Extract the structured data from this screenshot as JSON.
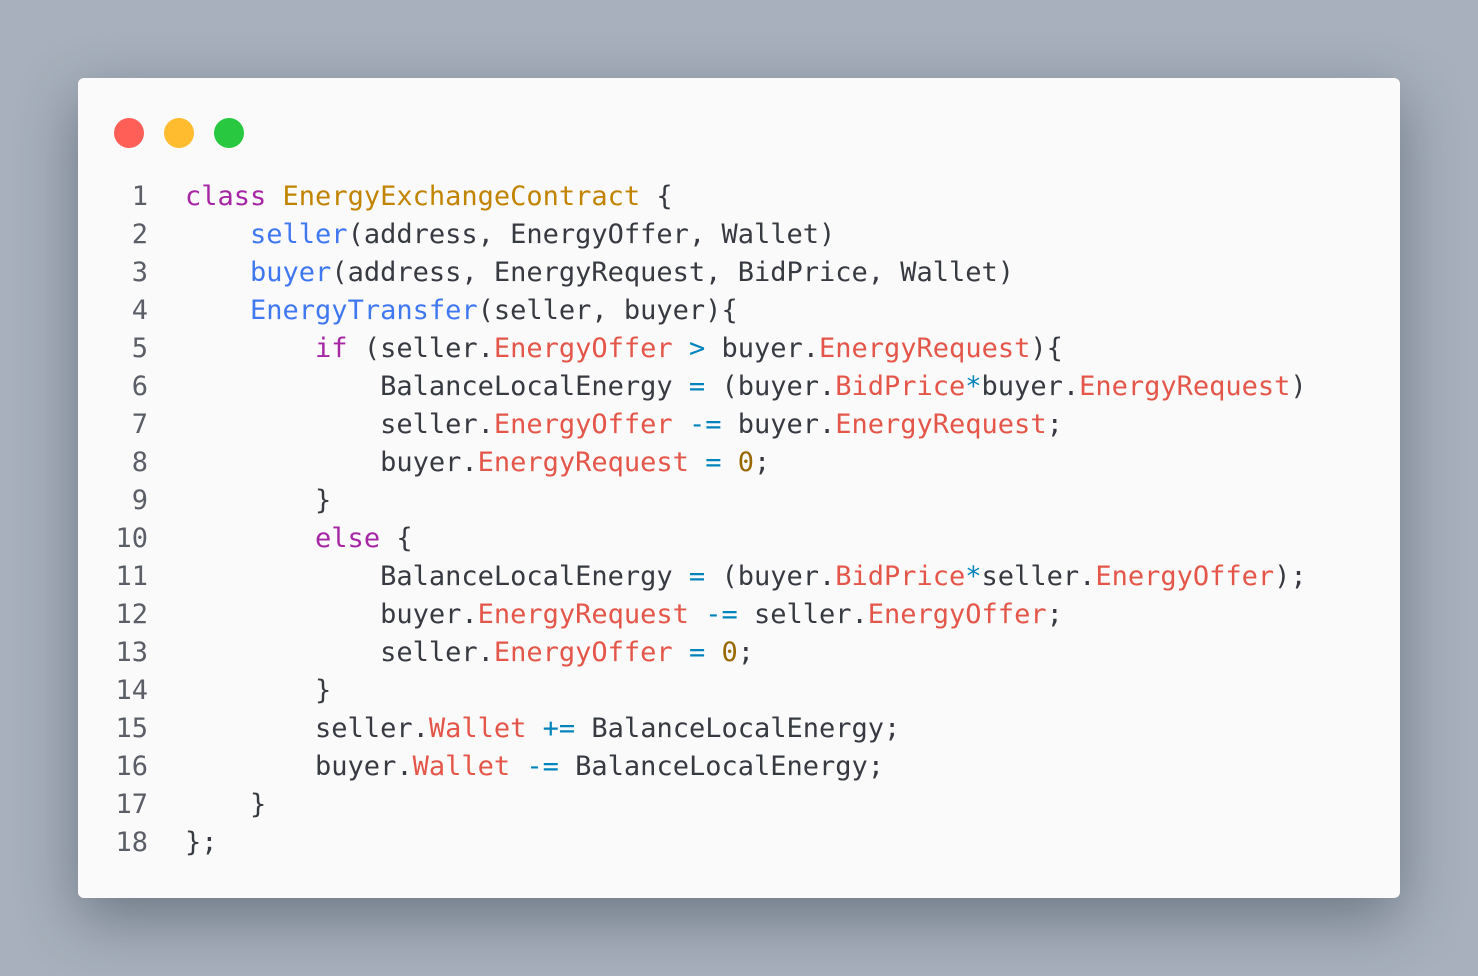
{
  "colors": {
    "background": "#a7b0bc",
    "window": "#fafafa",
    "close_dot": "#ff5f57",
    "minimize_dot": "#febc2e",
    "maximize_dot": "#28c840",
    "plain": "#383a42",
    "keyword": "#a626a4",
    "class_name": "#c18401",
    "function": "#4078f2",
    "property": "#e45649",
    "operator": "#0184bc",
    "number": "#986801",
    "line_number": "#5b5e66"
  },
  "icons": {
    "close": "red-circle",
    "minimize": "yellow-circle",
    "maximize": "green-circle"
  },
  "code": {
    "language": "pseudo-code",
    "lines": [
      {
        "num": "1",
        "tokens": [
          {
            "t": "kw",
            "v": "class"
          },
          {
            "t": "p",
            "v": " "
          },
          {
            "t": "cls",
            "v": "EnergyExchangeContract"
          },
          {
            "t": "p",
            "v": " {"
          }
        ]
      },
      {
        "num": "2",
        "tokens": [
          {
            "t": "p",
            "v": "    "
          },
          {
            "t": "fn",
            "v": "seller"
          },
          {
            "t": "p",
            "v": "(address, EnergyOffer, Wallet)"
          }
        ]
      },
      {
        "num": "3",
        "tokens": [
          {
            "t": "p",
            "v": "    "
          },
          {
            "t": "fn",
            "v": "buyer"
          },
          {
            "t": "p",
            "v": "(address, EnergyRequest, BidPrice, Wallet)"
          }
        ]
      },
      {
        "num": "4",
        "tokens": [
          {
            "t": "p",
            "v": "    "
          },
          {
            "t": "fn",
            "v": "EnergyTransfer"
          },
          {
            "t": "p",
            "v": "(seller, buyer){"
          }
        ]
      },
      {
        "num": "5",
        "tokens": [
          {
            "t": "p",
            "v": "        "
          },
          {
            "t": "kw",
            "v": "if"
          },
          {
            "t": "p",
            "v": " (seller."
          },
          {
            "t": "prop",
            "v": "EnergyOffer"
          },
          {
            "t": "p",
            "v": " "
          },
          {
            "t": "op",
            "v": ">"
          },
          {
            "t": "p",
            "v": " buyer."
          },
          {
            "t": "prop",
            "v": "EnergyRequest"
          },
          {
            "t": "p",
            "v": "){"
          }
        ]
      },
      {
        "num": "6",
        "tokens": [
          {
            "t": "p",
            "v": "            BalanceLocalEnergy "
          },
          {
            "t": "op",
            "v": "="
          },
          {
            "t": "p",
            "v": " (buyer."
          },
          {
            "t": "prop",
            "v": "BidPrice"
          },
          {
            "t": "op",
            "v": "*"
          },
          {
            "t": "p",
            "v": "buyer."
          },
          {
            "t": "prop",
            "v": "EnergyRequest"
          },
          {
            "t": "p",
            "v": ")"
          }
        ]
      },
      {
        "num": "7",
        "tokens": [
          {
            "t": "p",
            "v": "            seller."
          },
          {
            "t": "prop",
            "v": "EnergyOffer"
          },
          {
            "t": "p",
            "v": " "
          },
          {
            "t": "op",
            "v": "-="
          },
          {
            "t": "p",
            "v": " buyer."
          },
          {
            "t": "prop",
            "v": "EnergyRequest"
          },
          {
            "t": "p",
            "v": ";"
          }
        ]
      },
      {
        "num": "8",
        "tokens": [
          {
            "t": "p",
            "v": "            buyer."
          },
          {
            "t": "prop",
            "v": "EnergyRequest"
          },
          {
            "t": "p",
            "v": " "
          },
          {
            "t": "op",
            "v": "="
          },
          {
            "t": "p",
            "v": " "
          },
          {
            "t": "num",
            "v": "0"
          },
          {
            "t": "p",
            "v": ";"
          }
        ]
      },
      {
        "num": "9",
        "tokens": [
          {
            "t": "p",
            "v": "        }"
          }
        ]
      },
      {
        "num": "10",
        "tokens": [
          {
            "t": "p",
            "v": "        "
          },
          {
            "t": "kw",
            "v": "else"
          },
          {
            "t": "p",
            "v": " {"
          }
        ]
      },
      {
        "num": "11",
        "tokens": [
          {
            "t": "p",
            "v": "            BalanceLocalEnergy "
          },
          {
            "t": "op",
            "v": "="
          },
          {
            "t": "p",
            "v": " (buyer."
          },
          {
            "t": "prop",
            "v": "BidPrice"
          },
          {
            "t": "op",
            "v": "*"
          },
          {
            "t": "p",
            "v": "seller."
          },
          {
            "t": "prop",
            "v": "EnergyOffer"
          },
          {
            "t": "p",
            "v": ");"
          }
        ]
      },
      {
        "num": "12",
        "tokens": [
          {
            "t": "p",
            "v": "            buyer."
          },
          {
            "t": "prop",
            "v": "EnergyRequest"
          },
          {
            "t": "p",
            "v": " "
          },
          {
            "t": "op",
            "v": "-="
          },
          {
            "t": "p",
            "v": " seller."
          },
          {
            "t": "prop",
            "v": "EnergyOffer"
          },
          {
            "t": "p",
            "v": ";"
          }
        ]
      },
      {
        "num": "13",
        "tokens": [
          {
            "t": "p",
            "v": "            seller."
          },
          {
            "t": "prop",
            "v": "EnergyOffer"
          },
          {
            "t": "p",
            "v": " "
          },
          {
            "t": "op",
            "v": "="
          },
          {
            "t": "p",
            "v": " "
          },
          {
            "t": "num",
            "v": "0"
          },
          {
            "t": "p",
            "v": ";"
          }
        ]
      },
      {
        "num": "14",
        "tokens": [
          {
            "t": "p",
            "v": "        }"
          }
        ]
      },
      {
        "num": "15",
        "tokens": [
          {
            "t": "p",
            "v": "        seller."
          },
          {
            "t": "prop",
            "v": "Wallet"
          },
          {
            "t": "p",
            "v": " "
          },
          {
            "t": "op",
            "v": "+="
          },
          {
            "t": "p",
            "v": " BalanceLocalEnergy;"
          }
        ]
      },
      {
        "num": "16",
        "tokens": [
          {
            "t": "p",
            "v": "        buyer."
          },
          {
            "t": "prop",
            "v": "Wallet"
          },
          {
            "t": "p",
            "v": " "
          },
          {
            "t": "op",
            "v": "-="
          },
          {
            "t": "p",
            "v": " BalanceLocalEnergy;"
          }
        ]
      },
      {
        "num": "17",
        "tokens": [
          {
            "t": "p",
            "v": "    }"
          }
        ]
      },
      {
        "num": "18",
        "tokens": [
          {
            "t": "p",
            "v": "};"
          }
        ]
      }
    ]
  }
}
